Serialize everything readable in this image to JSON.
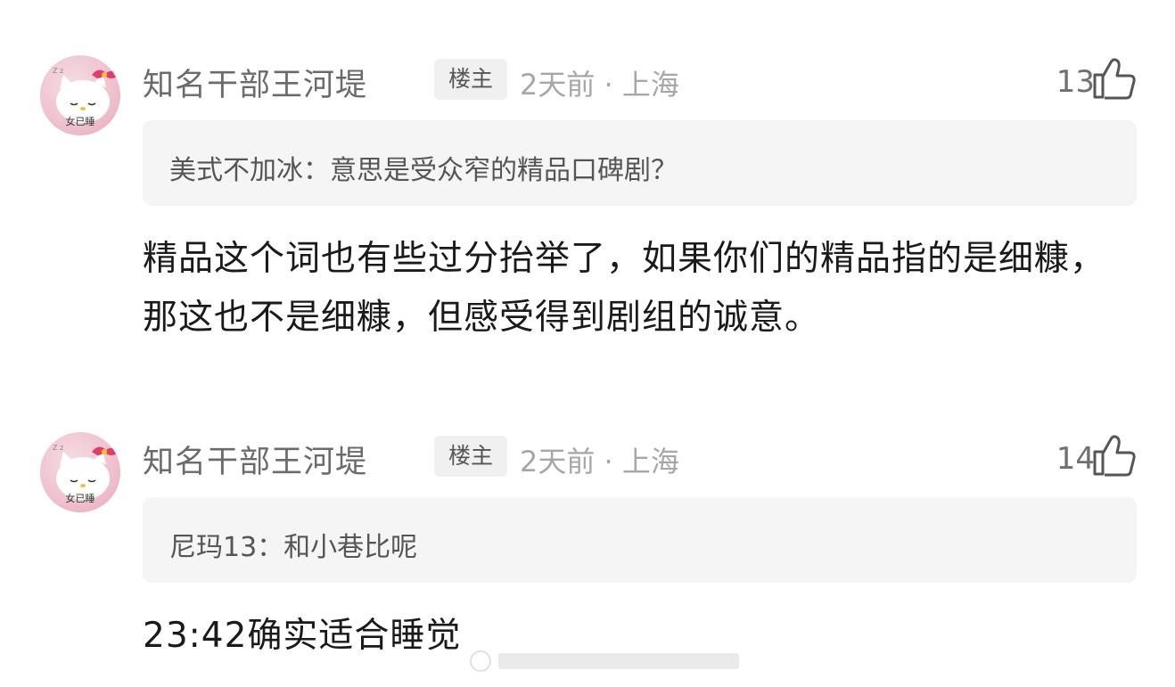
{
  "comments": [
    {
      "username": "知名干部王河堤",
      "badge": "楼主",
      "meta": "2天前 · 上海",
      "likes": "13",
      "avatar_text": "女已睡",
      "quote": "美式不加冰：意思是受众窄的精品口碑剧？",
      "body": "精品这个词也有些过分抬举了，如果你们的精品指的是细糠，那这也不是细糠，但感受得到剧组的诚意。"
    },
    {
      "username": "知名干部王河堤",
      "badge": "楼主",
      "meta": "2天前 · 上海",
      "likes": "14",
      "avatar_text": "女已睡",
      "quote": "尼玛13：和小巷比呢",
      "body": "23:42确实适合睡觉"
    }
  ],
  "icons": {
    "like": "thumbs-up-icon",
    "avatar": "hello-kitty-avatar"
  },
  "colors": {
    "username": "#6b6b6b",
    "meta": "#a7a7a7",
    "quote_bg": "#f5f5f5",
    "badge_bg": "#f0f0f0",
    "body": "#1a1a1a"
  }
}
